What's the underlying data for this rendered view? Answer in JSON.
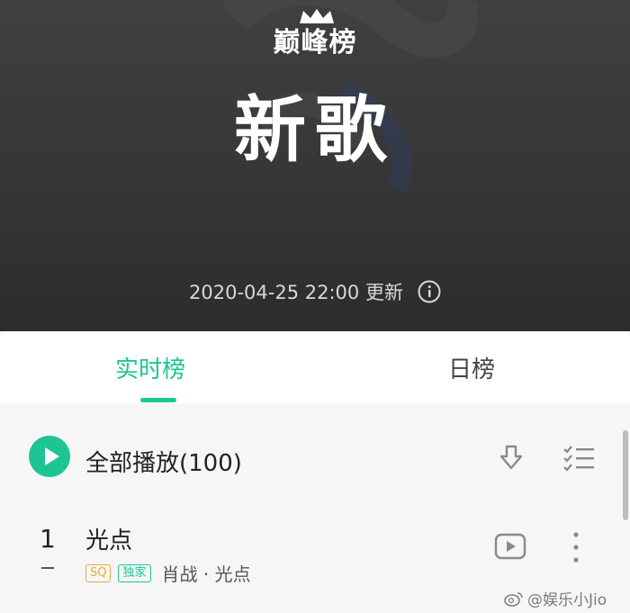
{
  "header": {
    "logo_text": "巅峰榜",
    "title": "新歌",
    "update_text": "2020-04-25 22:00 更新"
  },
  "tabs": [
    {
      "label": "实时榜",
      "active": true
    },
    {
      "label": "日榜",
      "active": false
    }
  ],
  "play_all": {
    "label": "全部播放(100)"
  },
  "songs": [
    {
      "rank": "1",
      "title": "光点",
      "badges": [
        "SQ",
        "独家"
      ],
      "artist": "肖战 · 光点"
    }
  ],
  "watermark": {
    "text": "@娱乐小Jio"
  },
  "colors": {
    "accent": "#1ec592",
    "sq_badge": "#e9a93a",
    "header_bg": "#343434"
  }
}
